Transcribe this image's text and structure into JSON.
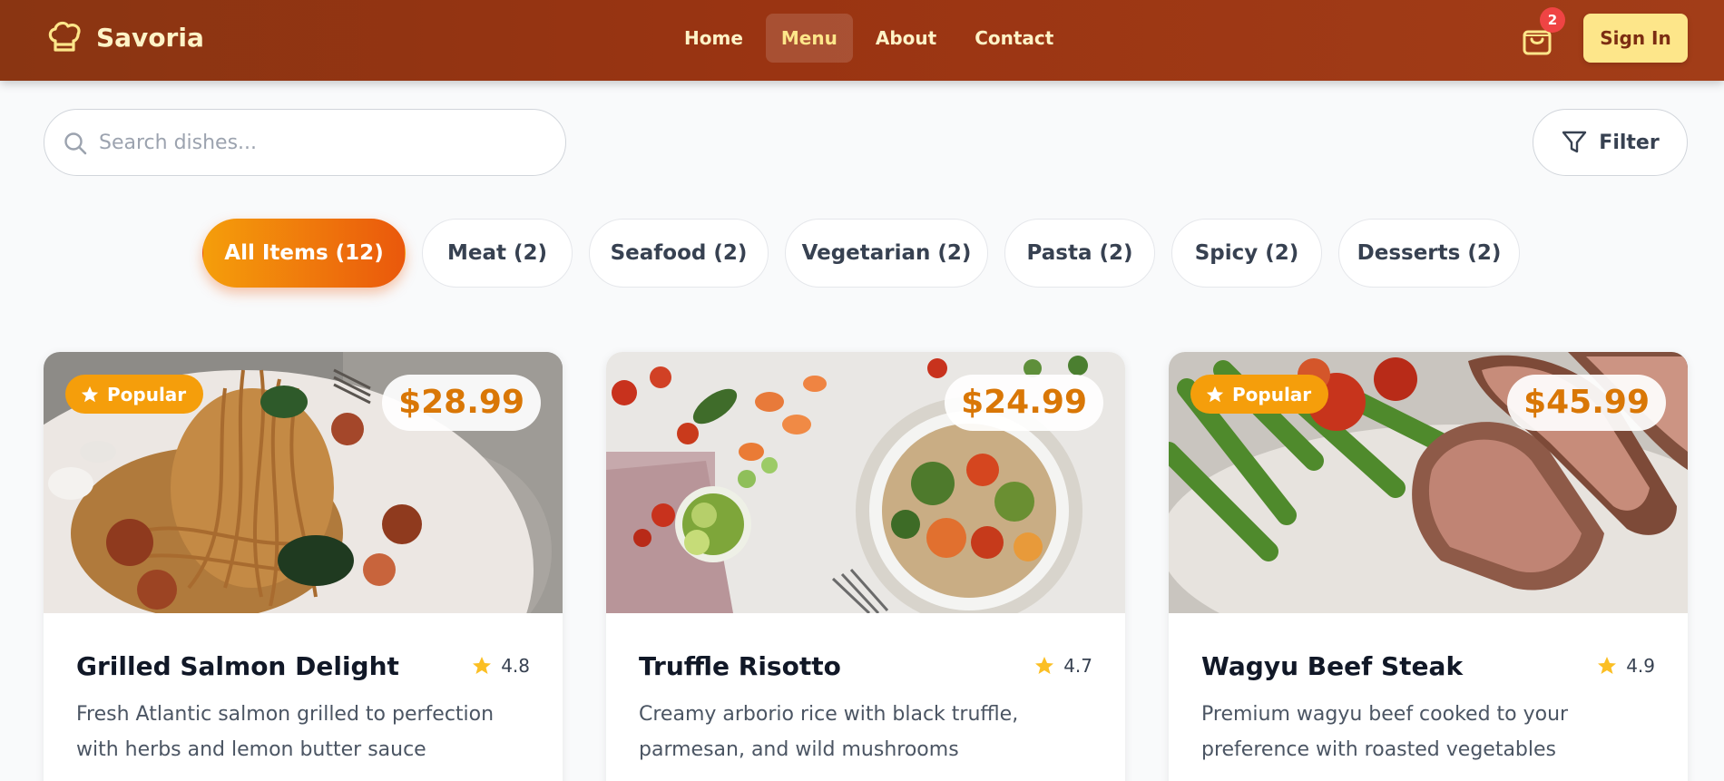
{
  "header": {
    "brand": "Savoria",
    "nav": [
      {
        "label": "Home",
        "active": false
      },
      {
        "label": "Menu",
        "active": true
      },
      {
        "label": "About",
        "active": false
      },
      {
        "label": "Contact",
        "active": false
      }
    ],
    "cart_count": "2",
    "signin_label": "Sign In"
  },
  "search": {
    "placeholder": "Search dishes...",
    "value": ""
  },
  "filter_label": "Filter",
  "categories": [
    {
      "label": "All Items (12)",
      "active": true
    },
    {
      "label": "Meat (2)",
      "active": false
    },
    {
      "label": "Seafood (2)",
      "active": false
    },
    {
      "label": "Vegetarian (2)",
      "active": false
    },
    {
      "label": "Pasta (2)",
      "active": false
    },
    {
      "label": "Spicy (2)",
      "active": false
    },
    {
      "label": "Desserts (2)",
      "active": false
    }
  ],
  "dishes": [
    {
      "name": "Grilled Salmon Delight",
      "price": "$28.99",
      "rating": "4.8",
      "popular": true,
      "badge_label": "Popular",
      "description": "Fresh Atlantic salmon grilled to perfection with herbs and lemon butter sauce",
      "image": "spaghetti-with-tomatoes"
    },
    {
      "name": "Truffle Risotto",
      "price": "$24.99",
      "rating": "4.7",
      "popular": false,
      "badge_label": "",
      "description": "Creamy arborio rice with black truffle, parmesan, and wild mushrooms",
      "image": "vegetable-grain-bowl"
    },
    {
      "name": "Wagyu Beef Steak",
      "price": "$45.99",
      "rating": "4.9",
      "popular": true,
      "badge_label": "Popular",
      "description": "Premium wagyu beef cooked to your preference with roasted vegetables",
      "image": "sliced-steak-with-asparagus"
    }
  ],
  "colors": {
    "header": "#9a3412",
    "accent": "#f59e0b",
    "accent_dark": "#ea580c",
    "price": "#d97706",
    "star": "#fbbf24",
    "badge": "#ef4444"
  },
  "icons": {
    "logo": "chef-hat-icon",
    "cart": "shopping-bag-icon",
    "search": "search-icon",
    "filter": "funnel-icon",
    "rating": "star-icon"
  }
}
